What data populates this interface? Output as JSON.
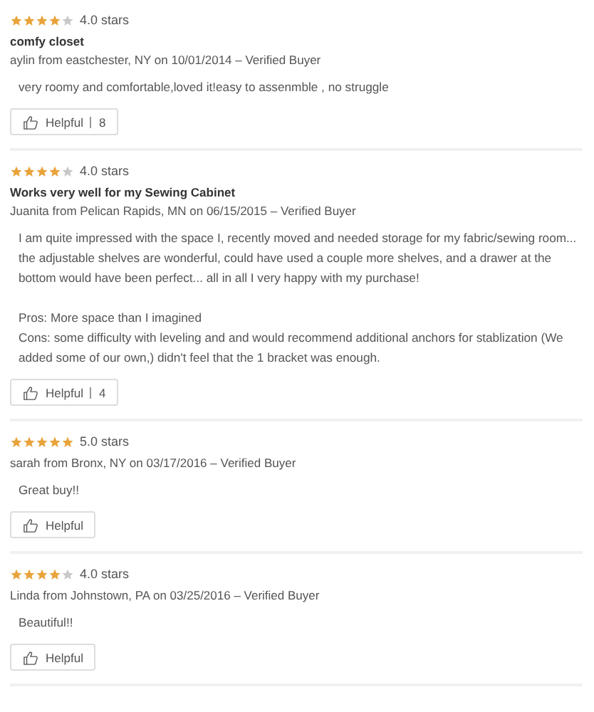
{
  "reviews": [
    {
      "stars": 4,
      "rating": "4.0 stars",
      "title": "comfy closet",
      "byline": "aylin from eastchester, NY on 10/01/2014 – Verified Buyer",
      "body": "very roomy and comfortable,loved it!easy to assenmble , no struggle",
      "helpful": {
        "label": "Helpful",
        "count": "8"
      }
    },
    {
      "stars": 4,
      "rating": "4.0 stars",
      "title": "Works very well for my Sewing Cabinet",
      "byline": "Juanita from Pelican Rapids, MN on 06/15/2015 – Verified Buyer",
      "body": "I am quite impressed with the space I, recently moved and needed storage for my fabric/sewing room... the adjustable shelves are wonderful, could have used a couple more shelves, and a drawer at the bottom would have been perfect... all in all I very happy with my purchase!\n\nPros: More space than I imagined\nCons: some difficulty with leveling and and would recommend additional anchors for stablization (We added some of our own,) didn't feel that the 1 bracket was enough.",
      "helpful": {
        "label": "Helpful",
        "count": "4"
      }
    },
    {
      "stars": 5,
      "rating": "5.0 stars",
      "byline": "sarah from Bronx, NY on 03/17/2016 – Verified Buyer",
      "body": "Great buy!!",
      "helpful": {
        "label": "Helpful"
      }
    },
    {
      "stars": 4,
      "rating": "4.0 stars",
      "byline": "Linda from Johnstown, PA on 03/25/2016 – Verified Buyer",
      "body": "Beautiful!!",
      "helpful": {
        "label": "Helpful"
      }
    }
  ]
}
